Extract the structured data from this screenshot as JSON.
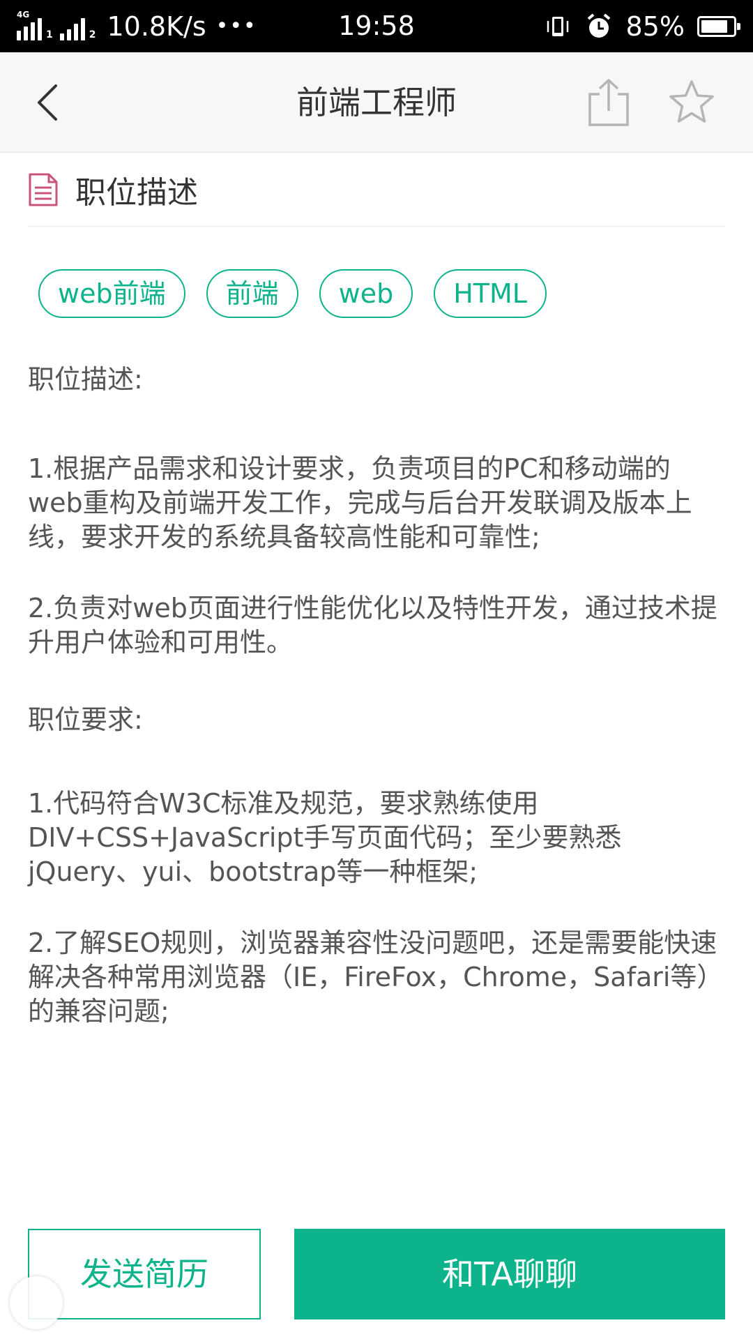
{
  "status_bar": {
    "network_tag": "4G",
    "sim1": "1",
    "sim2": "2",
    "speed": "10.8K/s",
    "more": "•••",
    "time": "19:58",
    "battery_percent": "85%",
    "battery_level": 0.85,
    "icons": [
      "signal-icon",
      "vibrate-icon",
      "alarm-icon",
      "battery-icon"
    ]
  },
  "header": {
    "title": "前端工程师",
    "back_icon": "chevron-left-icon",
    "share_icon": "share-icon",
    "favorite_icon": "star-icon"
  },
  "section": {
    "icon": "document-icon",
    "title": "职位描述"
  },
  "tags": [
    "web前端",
    "前端",
    "web",
    "HTML"
  ],
  "description": {
    "heading1": "职位描述:",
    "item1": "1.根据产品需求和设计要求，负责项目的PC和移动端的web重构及前端开发工作，完成与后台开发联调及版本上线，要求开发的系统具备较高性能和可靠性;",
    "item2": "2.负责对web页面进行性能优化以及特性开发，通过技术提升用户体验和可用性。",
    "heading2": "职位要求:",
    "req1": "1.代码符合W3C标准及规范，要求熟练使用DIV+CSS+JavaScript手写页面代码；至少要熟悉jQuery、yui、bootstrap等一种框架;",
    "req2": "2.了解SEO规则，浏览器兼容性没问题吧，还是需要能快速解决各种常用浏览器（IE，FireFox，Chrome，Safari等）的兼容问题;"
  },
  "actions": {
    "send_resume": "发送简历",
    "chat": "和TA聊聊"
  },
  "colors": {
    "accent": "#0cb38b",
    "status_bar_bg": "#000000",
    "header_bg": "#f7f7f7",
    "doc_icon": "#c9547a"
  }
}
